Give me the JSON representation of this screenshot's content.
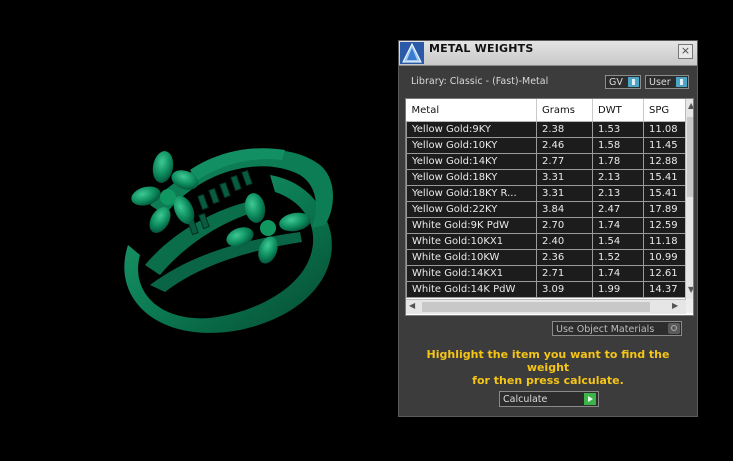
{
  "panel": {
    "title": "METAL WEIGHTS",
    "close": "×",
    "library_label": "Library: Classic - (Fast)-Metal",
    "unit_dropdown": "GV",
    "user_dropdown": "User",
    "use_object_materials": "Use Object Materials",
    "instruction_line1": "Highlight the item you want to find the weight",
    "instruction_line2": "for then press calculate.",
    "calculate_label": "Calculate"
  },
  "table": {
    "headers": [
      "Metal",
      "Grams",
      "DWT",
      "SPG"
    ],
    "rows": [
      [
        "Yellow Gold:9KY",
        "2.38",
        "1.53",
        "11.08"
      ],
      [
        "Yellow Gold:10KY",
        "2.46",
        "1.58",
        "11.45"
      ],
      [
        "Yellow Gold:14KY",
        "2.77",
        "1.78",
        "12.88"
      ],
      [
        "Yellow Gold:18KY",
        "3.31",
        "2.13",
        "15.41"
      ],
      [
        "Yellow Gold:18KY R...",
        "3.31",
        "2.13",
        "15.41"
      ],
      [
        "Yellow Gold:22KY",
        "3.84",
        "2.47",
        "17.89"
      ],
      [
        "White Gold:9K PdW",
        "2.70",
        "1.74",
        "12.59"
      ],
      [
        "White Gold:10KX1",
        "2.40",
        "1.54",
        "11.18"
      ],
      [
        "White Gold:10KW",
        "2.36",
        "1.52",
        "10.99"
      ],
      [
        "White Gold:14KX1",
        "2.71",
        "1.74",
        "12.61"
      ],
      [
        "White Gold:14K PdW",
        "3.09",
        "1.99",
        "14.37"
      ]
    ]
  },
  "colors": {
    "ring": "#0a6a4a",
    "instruction": "#f5c518",
    "panel_bg": "#3c3c3c"
  }
}
